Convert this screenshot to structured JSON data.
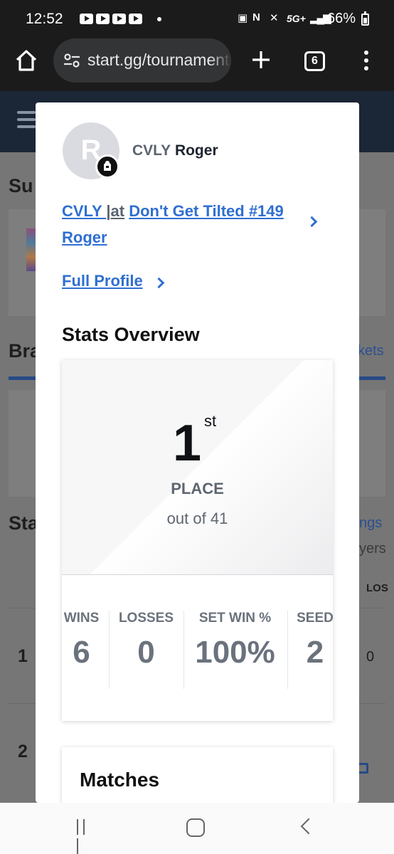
{
  "status_bar": {
    "time": "12:52",
    "network": "5G+",
    "battery": "66%"
  },
  "browser": {
    "url": "start.gg/tournament",
    "tab_count": "6"
  },
  "background": {
    "heading_1": "Su",
    "heading_2": "Bra",
    "heading_3": "Sta",
    "link_1": "kets",
    "link_2": "ngs",
    "text_1": "yers",
    "col_header": "LOS",
    "row_1_num": "1",
    "row_1_val": "0",
    "row_2_num": "2"
  },
  "profile": {
    "avatar_initial": "R",
    "prefix": "CVLY",
    "tag": "Roger",
    "event_prefix": "CVLY ",
    "event_separator": "|",
    "event_at": "at",
    "event_name": "Don't Get Tilted #149",
    "event_tag": "Roger",
    "full_profile": "Full Profile"
  },
  "stats": {
    "title": "Stats Overview",
    "place": "1",
    "place_suffix": "st",
    "place_label": "PLACE",
    "out_of": "out of 41",
    "columns": [
      {
        "label": "WINS",
        "value": "6"
      },
      {
        "label": "LOSSES",
        "value": "0"
      },
      {
        "label": "SET WIN %",
        "value": "100%"
      },
      {
        "label": "SEED",
        "value": "2"
      }
    ]
  },
  "matches": {
    "title": "Matches"
  },
  "colors": {
    "link": "#2f6fd1",
    "nav_dark": "#1b2636",
    "text_muted": "#6a727c"
  }
}
